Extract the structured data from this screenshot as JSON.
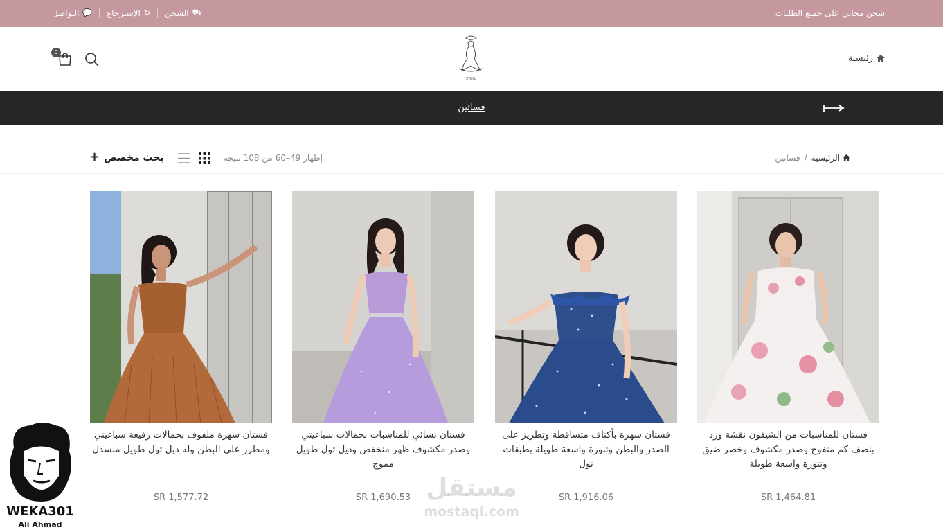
{
  "topbar": {
    "promo": "شحن مجاني على جميع الطلبات",
    "links": [
      {
        "label": "الشحن",
        "icon": "truck-icon",
        "glyph": "⛟"
      },
      {
        "label": "الإسترجاع",
        "icon": "return-icon",
        "glyph": "↻"
      },
      {
        "label": "التواصل",
        "icon": "chat-icon",
        "glyph": "💬"
      }
    ],
    "background": "#c5979e"
  },
  "header": {
    "home_label": "رئيسية",
    "logo_text": "STAYL",
    "cart_count": "0"
  },
  "navbar": {
    "link": "فساتين",
    "background": "#272727"
  },
  "toolbar": {
    "crumb_home": "الرئيسية",
    "crumb_sep": "/",
    "crumb_current": "فساتين",
    "result_text": "إظهار 49–60 من 108 نتيجة",
    "filter_label": "بحث مخصص",
    "plus": "+"
  },
  "products": [
    {
      "title": "فستان للمناسبات من الشيفون نقشة ورد بنصف كم منفوخ وصدر مكشوف وخصر ضيق وتنورة واسعة طويلة",
      "price": "SR 1,464.81",
      "palette": "floral"
    },
    {
      "title": "فستان سهرة بأكتاف متساقطة وتطريز على الصدر والبطن وتنورة واسعة طويلة بطبقات تول",
      "price": "SR 1,916.06",
      "palette": "navy"
    },
    {
      "title": "فستان نسائي للمناسبات بحمالات سباغيتي وصدر مكشوف ظهر منخفض وذيل تول طويل مموج",
      "price": "SR 1,690.53",
      "palette": "lilac"
    },
    {
      "title": "فستان سهرة ملفوف بحمالات رفيعة سباغيتي ومطرز على البطن وله ذيل تول طويل منسدل",
      "price": "SR 1,577.72",
      "palette": "rust"
    }
  ],
  "watermark": {
    "arabic": "مستقل",
    "latin": "mostaql.com"
  },
  "badge": {
    "name": "WEKA301",
    "sub": "Ali Ahmad"
  }
}
